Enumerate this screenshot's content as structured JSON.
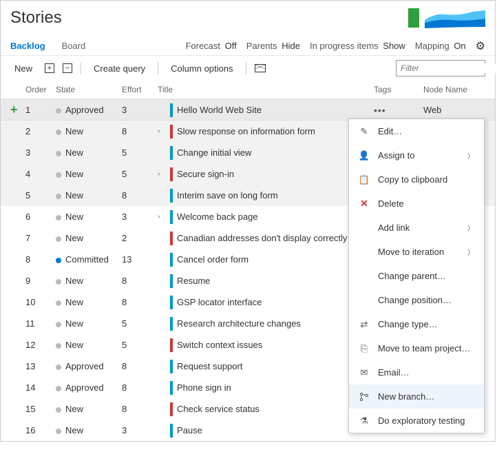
{
  "title": "Stories",
  "tabs": {
    "backlog": "Backlog",
    "board": "Board"
  },
  "options": {
    "forecast_label": "Forecast",
    "forecast_value": "Off",
    "parents_label": "Parents",
    "parents_value": "Hide",
    "inprogress_label": "In progress items",
    "inprogress_value": "Show",
    "mapping_label": "Mapping",
    "mapping_value": "On"
  },
  "toolbar": {
    "new": "New",
    "create_query": "Create query",
    "column_options": "Column options"
  },
  "filter_placeholder": "Filter",
  "columns": {
    "order": "Order",
    "state": "State",
    "effort": "Effort",
    "title": "Title",
    "tags": "Tags",
    "node": "Node Name"
  },
  "node_value": "Web",
  "rows": [
    {
      "order": "1",
      "state": "Approved",
      "dot": "gray",
      "effort": "3",
      "expand": "",
      "bar": "blue",
      "title": "Hello World Web Site",
      "sel": true,
      "ellipsis": true
    },
    {
      "order": "2",
      "state": "New",
      "dot": "gray",
      "effort": "8",
      "expand": ">",
      "bar": "red",
      "title": "Slow response on information form",
      "sel": true
    },
    {
      "order": "3",
      "state": "New",
      "dot": "gray",
      "effort": "5",
      "expand": "",
      "bar": "blue",
      "title": "Change initial view",
      "sel": true
    },
    {
      "order": "4",
      "state": "New",
      "dot": "gray",
      "effort": "5",
      "expand": ">",
      "bar": "red",
      "title": "Secure sign-in",
      "sel": true
    },
    {
      "order": "5",
      "state": "New",
      "dot": "gray",
      "effort": "8",
      "expand": "",
      "bar": "blue",
      "title": "Interim save on long form",
      "sel": true
    },
    {
      "order": "6",
      "state": "New",
      "dot": "gray",
      "effort": "3",
      "expand": ">",
      "bar": "blue",
      "title": "Welcome back page"
    },
    {
      "order": "7",
      "state": "New",
      "dot": "gray",
      "effort": "2",
      "expand": "",
      "bar": "red",
      "title": "Canadian addresses don't display correctly"
    },
    {
      "order": "8",
      "state": "Committed",
      "dot": "blue",
      "effort": "13",
      "expand": "",
      "bar": "blue",
      "title": "Cancel order form"
    },
    {
      "order": "9",
      "state": "New",
      "dot": "gray",
      "effort": "8",
      "expand": "",
      "bar": "blue",
      "title": "Resume"
    },
    {
      "order": "10",
      "state": "New",
      "dot": "gray",
      "effort": "8",
      "expand": "",
      "bar": "blue",
      "title": "GSP locator interface"
    },
    {
      "order": "11",
      "state": "New",
      "dot": "gray",
      "effort": "5",
      "expand": "",
      "bar": "blue",
      "title": "Research architecture changes"
    },
    {
      "order": "12",
      "state": "New",
      "dot": "gray",
      "effort": "5",
      "expand": "",
      "bar": "red",
      "title": "Switch context issues"
    },
    {
      "order": "13",
      "state": "Approved",
      "dot": "gray",
      "effort": "8",
      "expand": "",
      "bar": "blue",
      "title": "Request support"
    },
    {
      "order": "14",
      "state": "Approved",
      "dot": "gray",
      "effort": "8",
      "expand": "",
      "bar": "blue",
      "title": "Phone sign in"
    },
    {
      "order": "15",
      "state": "New",
      "dot": "gray",
      "effort": "8",
      "expand": "",
      "bar": "red",
      "title": "Check service status"
    },
    {
      "order": "16",
      "state": "New",
      "dot": "gray",
      "effort": "3",
      "expand": "",
      "bar": "blue",
      "title": "Pause"
    }
  ],
  "menu": {
    "edit": "Edit…",
    "assign": "Assign to",
    "copy": "Copy to clipboard",
    "delete": "Delete",
    "add_link": "Add link",
    "move_iter": "Move to iteration",
    "change_parent": "Change parent…",
    "change_position": "Change position…",
    "change_type": "Change type…",
    "move_project": "Move to team project…",
    "email": "Email…",
    "new_branch": "New branch…",
    "exploratory": "Do exploratory testing"
  }
}
